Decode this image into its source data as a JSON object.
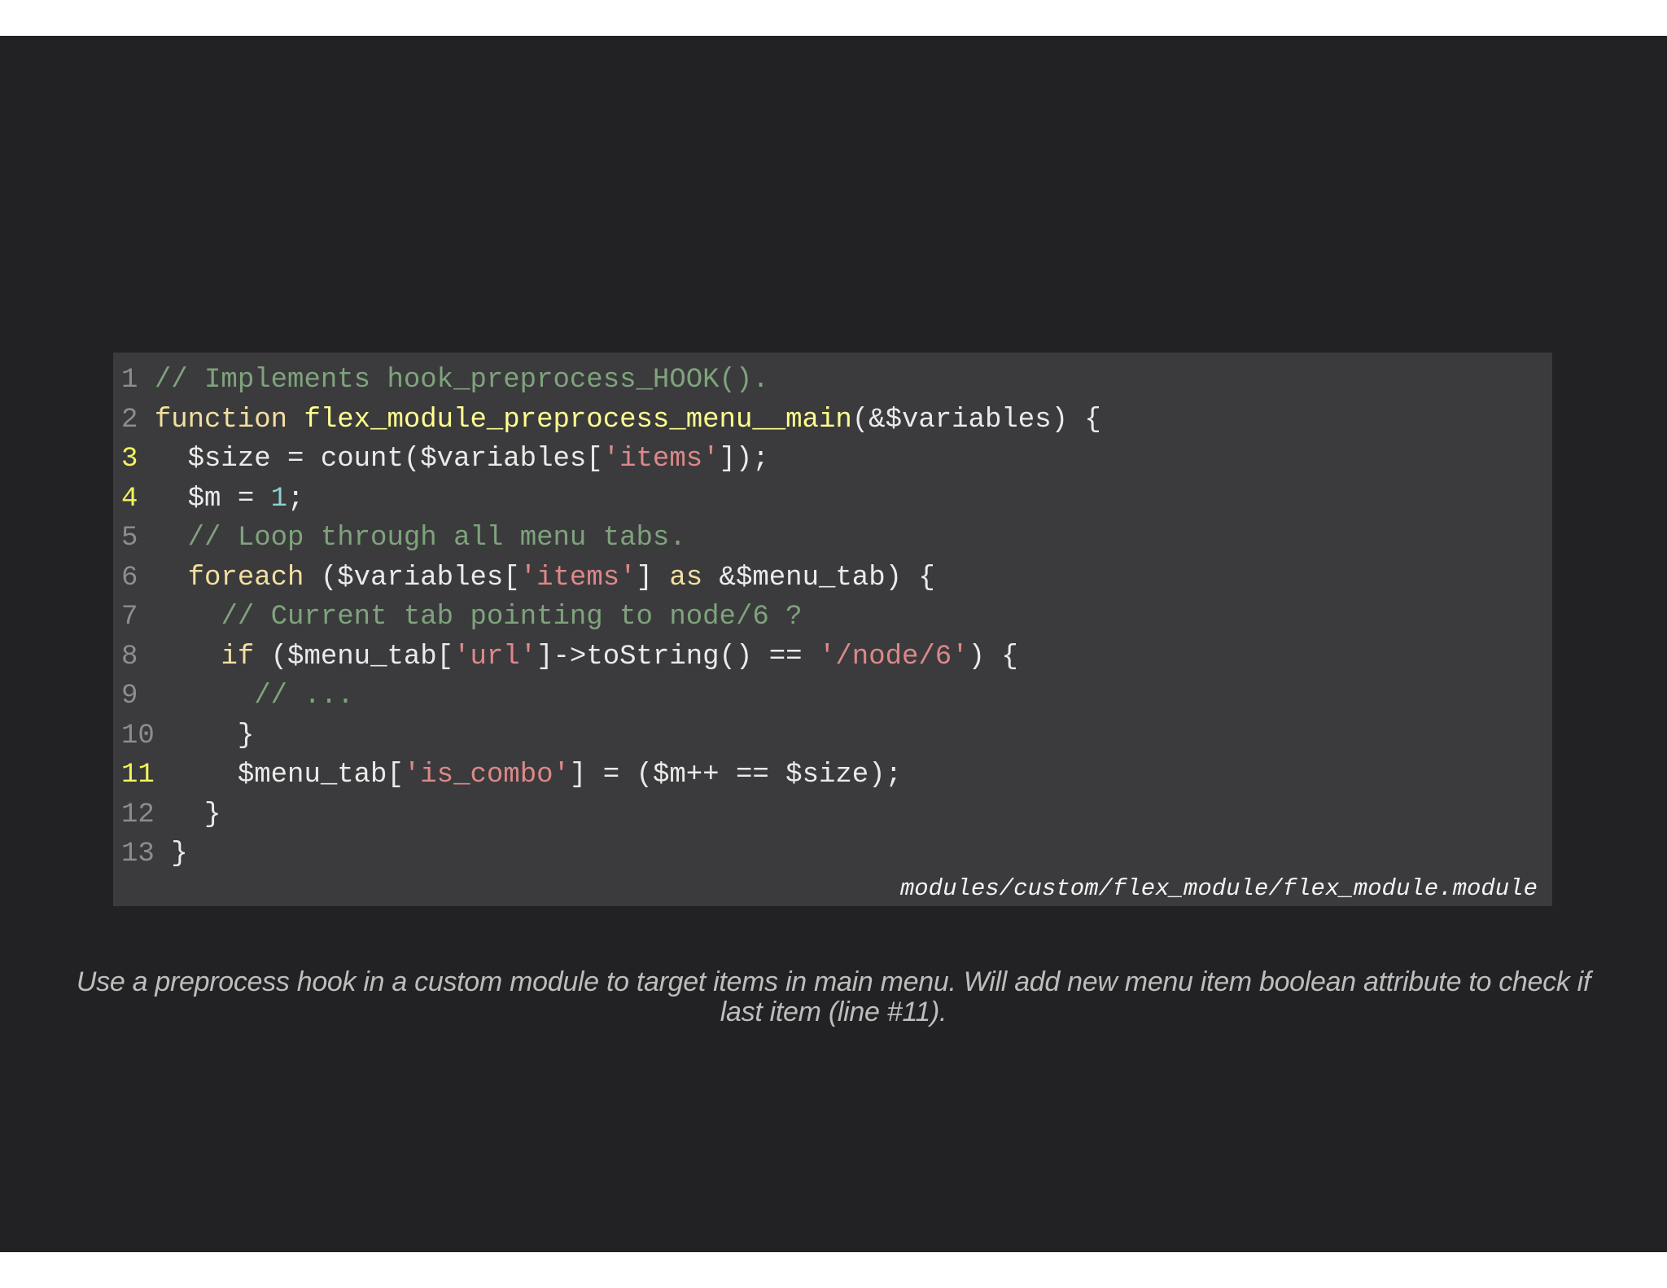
{
  "code": {
    "lines": [
      {
        "number": "1",
        "highlighted": false,
        "tokens": [
          {
            "t": " ",
            "k": "plain"
          },
          {
            "t": "// Implements hook_preprocess_HOOK().",
            "k": "comment"
          }
        ]
      },
      {
        "number": "2",
        "highlighted": false,
        "tokens": [
          {
            "t": " ",
            "k": "plain"
          },
          {
            "t": "function",
            "k": "keyword"
          },
          {
            "t": " ",
            "k": "plain"
          },
          {
            "t": "flex_module_preprocess_menu__main",
            "k": "fn"
          },
          {
            "t": "(&$variables) {",
            "k": "plain"
          }
        ]
      },
      {
        "number": "3",
        "highlighted": true,
        "tokens": [
          {
            "t": "   $size = count($variables[",
            "k": "plain"
          },
          {
            "t": "'items'",
            "k": "string"
          },
          {
            "t": "]);",
            "k": "plain"
          }
        ]
      },
      {
        "number": "4",
        "highlighted": true,
        "tokens": [
          {
            "t": "   $m = ",
            "k": "plain"
          },
          {
            "t": "1",
            "k": "number"
          },
          {
            "t": ";",
            "k": "plain"
          }
        ]
      },
      {
        "number": "5",
        "highlighted": false,
        "tokens": [
          {
            "t": "   ",
            "k": "plain"
          },
          {
            "t": "// Loop through all menu tabs.",
            "k": "comment"
          }
        ]
      },
      {
        "number": "6",
        "highlighted": false,
        "tokens": [
          {
            "t": "   ",
            "k": "plain"
          },
          {
            "t": "foreach",
            "k": "keyword"
          },
          {
            "t": " ($variables[",
            "k": "plain"
          },
          {
            "t": "'items'",
            "k": "string"
          },
          {
            "t": "] ",
            "k": "plain"
          },
          {
            "t": "as",
            "k": "keyword"
          },
          {
            "t": " &$menu_tab) {",
            "k": "plain"
          }
        ]
      },
      {
        "number": "7",
        "highlighted": false,
        "tokens": [
          {
            "t": "     ",
            "k": "plain"
          },
          {
            "t": "// Current tab pointing to node/6 ?",
            "k": "comment"
          }
        ]
      },
      {
        "number": "8",
        "highlighted": false,
        "tokens": [
          {
            "t": "     ",
            "k": "plain"
          },
          {
            "t": "if",
            "k": "keyword"
          },
          {
            "t": " ($menu_tab[",
            "k": "plain"
          },
          {
            "t": "'url'",
            "k": "string"
          },
          {
            "t": "]->toString() == ",
            "k": "plain"
          },
          {
            "t": "'/node/6'",
            "k": "string"
          },
          {
            "t": ") {",
            "k": "plain"
          }
        ]
      },
      {
        "number": "9",
        "highlighted": false,
        "tokens": [
          {
            "t": "       ",
            "k": "plain"
          },
          {
            "t": "// ...",
            "k": "comment"
          }
        ]
      },
      {
        "number": "10",
        "highlighted": false,
        "tokens": [
          {
            "t": "     }",
            "k": "plain"
          }
        ]
      },
      {
        "number": "11",
        "highlighted": true,
        "tokens": [
          {
            "t": "     $menu_tab[",
            "k": "plain"
          },
          {
            "t": "'is_combo'",
            "k": "string"
          },
          {
            "t": "] = ($m++ == $size);",
            "k": "plain"
          }
        ]
      },
      {
        "number": "12",
        "highlighted": false,
        "tokens": [
          {
            "t": "   }",
            "k": "plain"
          }
        ]
      },
      {
        "number": "13",
        "highlighted": false,
        "tokens": [
          {
            "t": " }",
            "k": "plain"
          }
        ]
      }
    ],
    "file_path": "modules/custom/flex_module/flex_module.module"
  },
  "caption": "Use a preprocess hook in a custom module to target items in main menu. Will add new menu item boolean attribute to check if last item (line #11).",
  "colors": {
    "slide_background": "#222224",
    "code_background": "#3b3b3d",
    "comment": "#7fa37c",
    "keyword": "#f3dfa0",
    "function_name": "#ffff90",
    "string": "#dd8888",
    "number": "#8fd0d0",
    "line_number": "#8d8d8d",
    "line_number_highlight": "#f4f45a"
  }
}
